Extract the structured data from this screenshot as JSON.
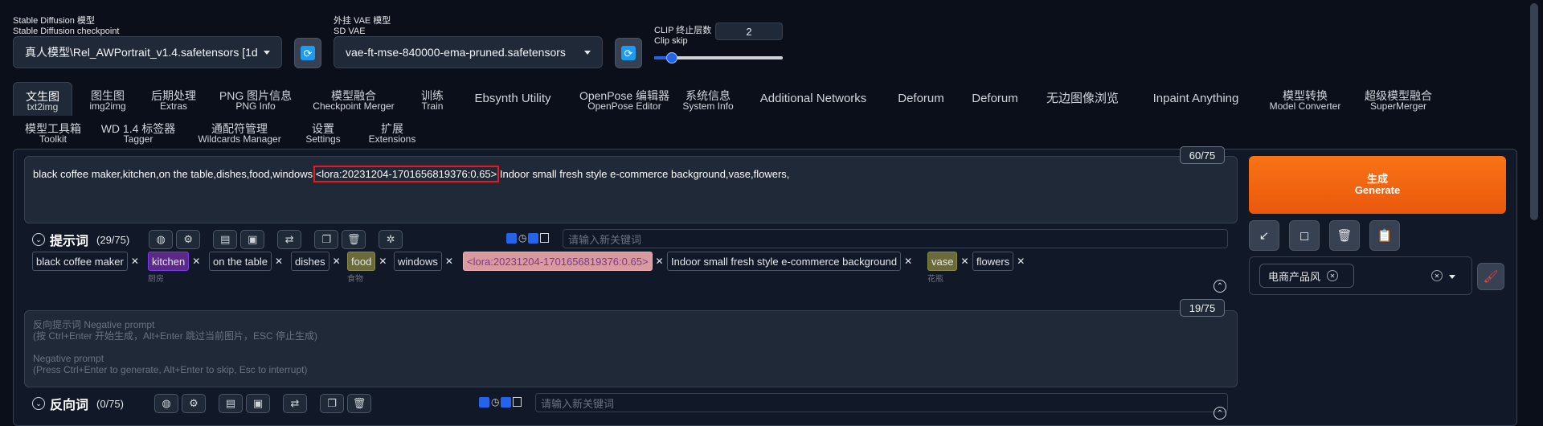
{
  "top": {
    "checkpoint_label_cn": "Stable Diffusion 模型",
    "checkpoint_label_en": "Stable Diffusion checkpoint",
    "checkpoint_value": "真人模型\\Rel_AWPortrait_v1.4.safetensors [1d",
    "vae_label_cn": "外挂 VAE 模型",
    "vae_label_en": "SD VAE",
    "vae_value": "vae-ft-mse-840000-ema-pruned.safetensors",
    "clip_label_cn": "CLIP 终止层数",
    "clip_label_en": "Clip skip",
    "clip_value": "2",
    "clip_slider_fraction": 0.14
  },
  "tabs_row1": [
    {
      "cn": "文生图",
      "en": "txt2img"
    },
    {
      "cn": "图生图",
      "en": "img2img"
    },
    {
      "cn": "后期处理",
      "en": "Extras"
    },
    {
      "cn": "PNG 图片信息",
      "en": "PNG Info"
    },
    {
      "cn": "模型融合",
      "en": "Checkpoint Merger"
    },
    {
      "cn": "训练",
      "en": "Train"
    },
    {
      "cn": "Ebsynth Utility",
      "en": ""
    },
    {
      "cn": "OpenPose 编辑器",
      "en": "OpenPose Editor"
    },
    {
      "cn": "系统信息",
      "en": "System Info"
    },
    {
      "cn": "Additional Networks",
      "en": ""
    },
    {
      "cn": "Deforum",
      "en": ""
    },
    {
      "cn": "Deforum",
      "en": ""
    },
    {
      "cn": "无边图像浏览",
      "en": ""
    },
    {
      "cn": "Inpaint Anything",
      "en": ""
    },
    {
      "cn": "模型转换",
      "en": "Model Converter"
    },
    {
      "cn": "超级模型融合",
      "en": "SuperMerger"
    }
  ],
  "tabs_row2": [
    {
      "cn": "模型工具箱",
      "en": "Toolkit"
    },
    {
      "cn": "WD 1.4 标签器",
      "en": "Tagger"
    },
    {
      "cn": "通配符管理",
      "en": "Wildcards Manager"
    },
    {
      "cn": "设置",
      "en": "Settings"
    },
    {
      "cn": "扩展",
      "en": "Extensions"
    }
  ],
  "prompt": {
    "counter": "60/75",
    "text_before": "black coffee maker,kitchen,on the table,dishes,food,windows,",
    "text_highlight": "<lora:20231204-1701656819376:0.65>",
    "text_after": ",Indoor small fresh style e-commerce background,vase,flowers,",
    "title": "提示词",
    "count": "(29/75)",
    "keyword_placeholder": "请输入新关键词",
    "tags": [
      {
        "text": "black coffee maker",
        "sub": "",
        "style": "plain"
      },
      {
        "text": "kitchen",
        "sub": "厨房",
        "style": "purple"
      },
      {
        "text": "on the table",
        "sub": "",
        "style": "plain"
      },
      {
        "text": "dishes",
        "sub": "",
        "style": "plain"
      },
      {
        "text": "food",
        "sub": "食物",
        "style": "olive"
      },
      {
        "text": "windows",
        "sub": "",
        "style": "plain"
      },
      {
        "text": "<lora:20231204-1701656819376:0.65>",
        "sub": "",
        "style": "pink"
      },
      {
        "text": "Indoor small fresh style e-commerce background",
        "sub": "",
        "style": "plain"
      },
      {
        "text": "vase",
        "sub": "花瓶",
        "style": "olive"
      },
      {
        "text": "flowers",
        "sub": "",
        "style": "plain"
      }
    ]
  },
  "negative": {
    "counter": "19/75",
    "placeholder_line1": "反向提示词 Negative prompt",
    "placeholder_line2": "(按 Ctrl+Enter 开始生成，Alt+Enter 跳过当前图片，ESC 停止生成)",
    "placeholder_line3": "Negative prompt",
    "placeholder_line4": "(Press Ctrl+Enter to generate, Alt+Enter to skip, Esc to interrupt)",
    "title": "反向词",
    "count": "(0/75)",
    "keyword_placeholder": "请输入新关键词"
  },
  "right": {
    "generate_cn": "生成",
    "generate_en": "Generate",
    "style_chip": "电商产品风",
    "colors": {
      "accent": "#ea580c",
      "bg": "#0b0f19"
    }
  }
}
